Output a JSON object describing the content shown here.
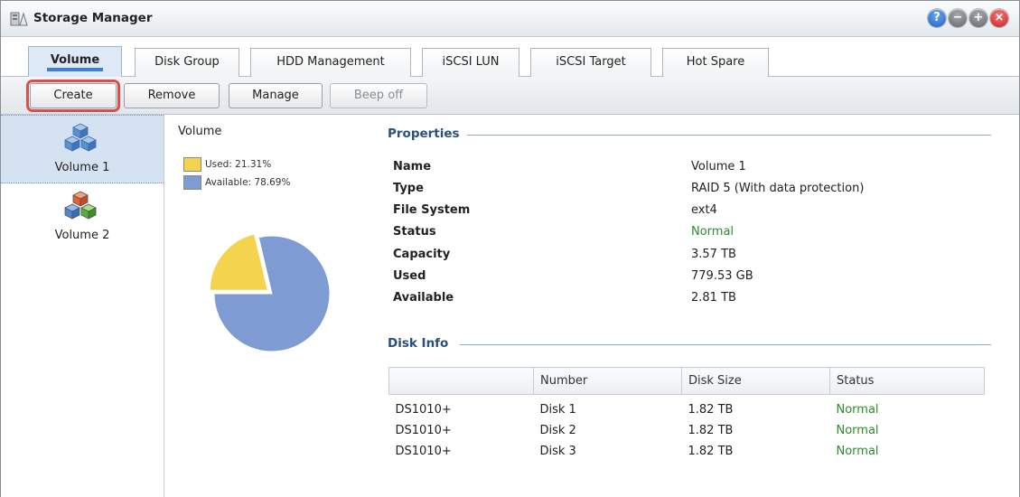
{
  "window": {
    "title": "Storage Manager"
  },
  "tabs": [
    {
      "label": "Volume",
      "active": true
    },
    {
      "label": "Disk Group"
    },
    {
      "label": "HDD Management"
    },
    {
      "label": "iSCSI LUN"
    },
    {
      "label": "iSCSI Target"
    },
    {
      "label": "Hot Spare"
    }
  ],
  "toolbar": {
    "create_label": "Create",
    "remove_label": "Remove",
    "manage_label": "Manage",
    "beep_off_label": "Beep off"
  },
  "volumes": [
    {
      "label": "Volume 1",
      "selected": true
    },
    {
      "label": "Volume 2"
    }
  ],
  "usage": {
    "heading": "Volume",
    "used_label": "Used: 21.31%",
    "available_label": "Available: 78.69%",
    "used_percent": 21.31,
    "available_percent": 78.69,
    "used_color": "#f4d44f",
    "available_color": "#7f9bd3"
  },
  "properties": {
    "heading": "Properties",
    "rows": [
      {
        "label": "Name",
        "value": "Volume 1"
      },
      {
        "label": "Type",
        "value": "RAID 5 (With data protection)"
      },
      {
        "label": "File System",
        "value": "ext4"
      },
      {
        "label": "Status",
        "value": "Normal"
      },
      {
        "label": "Capacity",
        "value": "3.57 TB"
      },
      {
        "label": "Used",
        "value": "779.53 GB"
      },
      {
        "label": "Available",
        "value": "2.81 TB"
      }
    ]
  },
  "disk_info": {
    "heading": "Disk Info",
    "columns": [
      "",
      "Number",
      "Disk Size",
      "Status"
    ],
    "rows": [
      [
        "DS1010+",
        "Disk 1",
        "1.82 TB",
        "Normal"
      ],
      [
        "DS1010+",
        "Disk 2",
        "1.82 TB",
        "Normal"
      ],
      [
        "DS1010+",
        "Disk 3",
        "1.82 TB",
        "Normal"
      ]
    ]
  },
  "colors": {
    "status_normal": "#2e8b2e",
    "accent": "#3b7fd6",
    "highlight_border": "#d9504a"
  }
}
